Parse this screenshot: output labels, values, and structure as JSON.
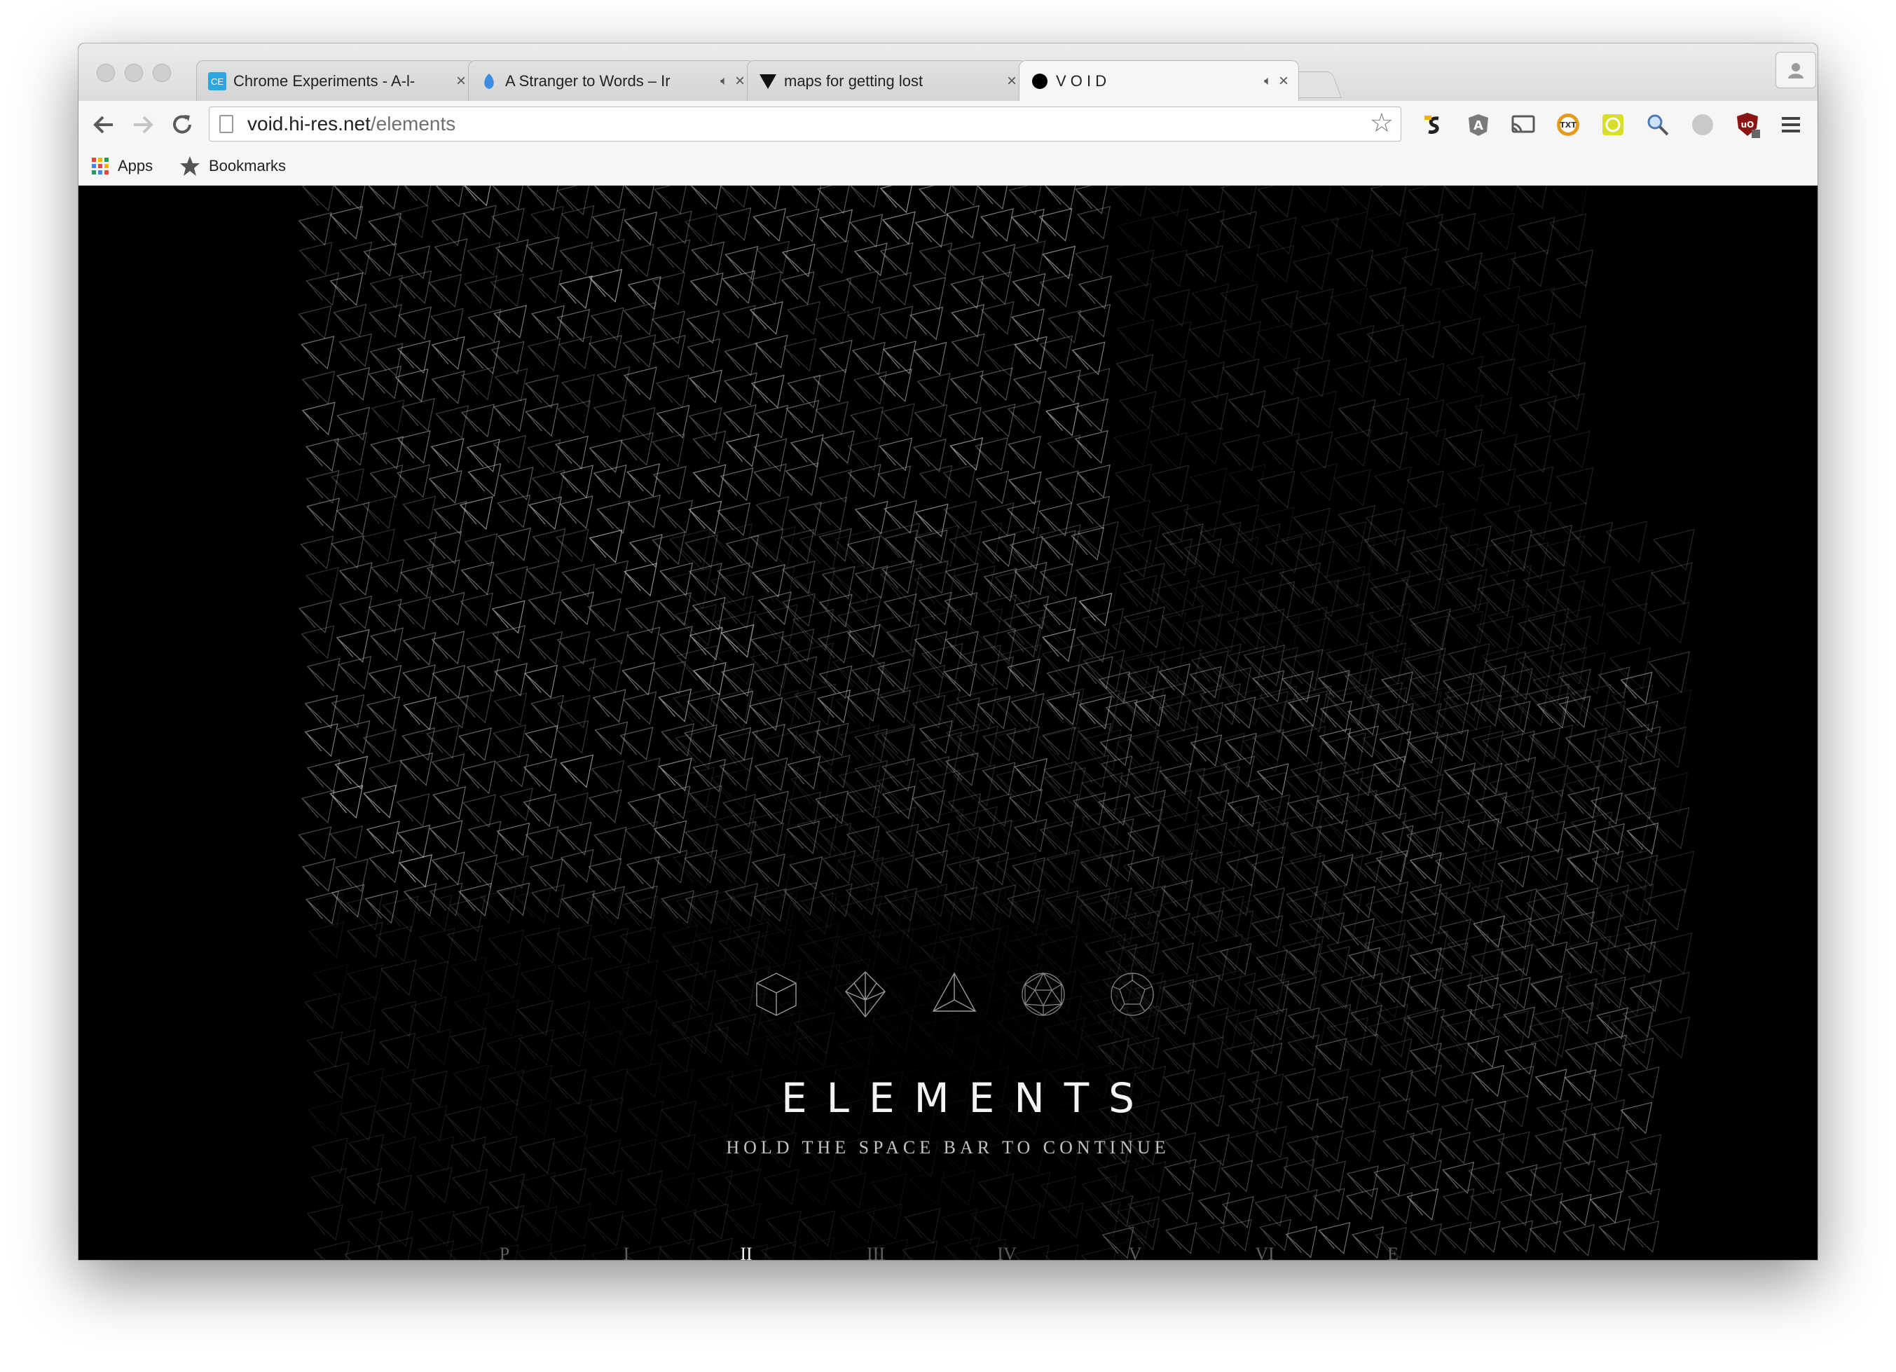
{
  "browser": {
    "tabs": [
      {
        "title": "Chrome Experiments - A-l-",
        "favicon": "chrome-experiments-favicon",
        "active": false,
        "audio": false
      },
      {
        "title": "A Stranger to Words – Ir",
        "favicon": "stranger-to-words-favicon",
        "active": false,
        "audio": true
      },
      {
        "title": "maps for getting lost",
        "favicon": "triangle-favicon",
        "active": false,
        "audio": false
      },
      {
        "title": "V O I D",
        "favicon": "black-circle-favicon",
        "active": true,
        "audio": true
      }
    ],
    "url": {
      "domain": "void.hi-res.net",
      "path": "/elements"
    },
    "bookmarks": [
      {
        "label": "Apps",
        "icon": "apps-grid-icon"
      },
      {
        "label": "Bookmarks",
        "icon": "star-icon"
      }
    ],
    "extensions": [
      "stylish-icon",
      "angular-icon",
      "cast-icon",
      "txt-icon",
      "yellow-ext-icon",
      "search-ext-icon",
      "gray-ext-icon",
      "ublock-icon",
      "menu-icon"
    ]
  },
  "page": {
    "shapes": [
      "cube-icon",
      "octahedron-icon",
      "tetrahedron-icon",
      "icosahedron-icon",
      "dodecahedron-icon"
    ],
    "heading": "ELEMENTS",
    "subtitle": "HOLD THE SPACE BAR TO CONTINUE",
    "chapters": [
      {
        "label": "P",
        "active": false
      },
      {
        "label": "I",
        "active": false
      },
      {
        "label": "II",
        "active": true
      },
      {
        "label": "III",
        "active": false
      },
      {
        "label": "IV",
        "active": false
      },
      {
        "label": "V",
        "active": false
      },
      {
        "label": "VI",
        "active": false
      },
      {
        "label": "E",
        "active": false
      }
    ]
  },
  "colors": {
    "page_background": "#000000",
    "accent_text": "#f3f3f3",
    "muted_text": "#5e5e5e"
  }
}
